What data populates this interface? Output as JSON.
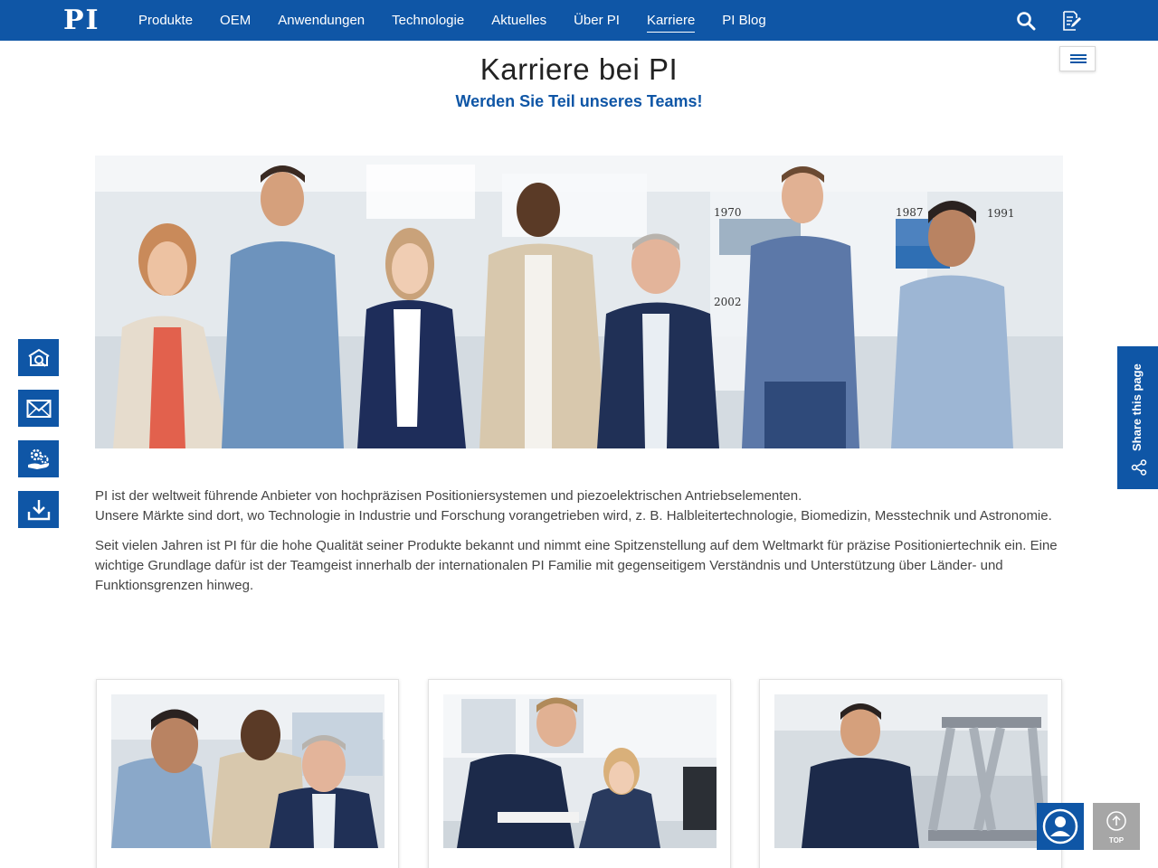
{
  "brand": {
    "logo_text": "PI",
    "primary_color": "#0f56a6",
    "top_button_color": "#a6a6a6"
  },
  "nav": {
    "items": [
      {
        "label": "Produkte"
      },
      {
        "label": "OEM"
      },
      {
        "label": "Anwendungen"
      },
      {
        "label": "Technologie"
      },
      {
        "label": "Aktuelles"
      },
      {
        "label": "Über PI"
      },
      {
        "label": "Karriere",
        "active": true
      },
      {
        "label": "PI Blog"
      }
    ],
    "icons": [
      "search-icon",
      "edit-document-icon"
    ]
  },
  "header": {
    "title": "Karriere bei PI",
    "subtitle": "Werden Sie Teil unseres Teams!"
  },
  "hero": {
    "year_labels": [
      "1970",
      "1987",
      "1991",
      "2002"
    ]
  },
  "content": {
    "paragraph1_line1": "PI ist der weltweit führende Anbieter von hochpräzisen Positioniersystemen und piezoelektrischen Antriebselementen.",
    "paragraph1_line2": "Unsere Märkte sind dort, wo Technologie in Industrie und Forschung vorangetrieben wird, z. B. Halbleitertechnologie, Biomedizin, Messtechnik und Astronomie.",
    "paragraph2": "Seit vielen Jahren ist PI für die hohe Qualität seiner Produkte bekannt und nimmt eine Spitzenstellung auf dem Weltmarkt für präzise Positioniertechnik ein. Eine wichtige Grundlage dafür ist der Teamgeist innerhalb der internationalen PI Familie mit gegenseitigem Verständnis und Unterstützung über Länder- und Funktionsgrenzen hinweg."
  },
  "side_buttons": [
    "product-finder-icon",
    "mail-icon",
    "service-gear-icon",
    "download-icon"
  ],
  "share": {
    "label": "Share this page",
    "icon": "share-nodes-icon"
  },
  "cards": [
    {
      "image": "three-colleagues-photo"
    },
    {
      "image": "engineers-at-desk-photo"
    },
    {
      "image": "engineer-with-hexapod-photo"
    }
  ],
  "floating": {
    "chat_icon": "user-chat-icon",
    "top_label": "TOP",
    "top_icon": "arrow-up-circle-icon"
  }
}
